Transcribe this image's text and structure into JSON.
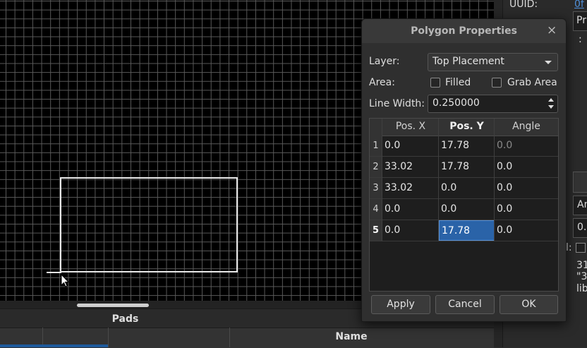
{
  "dialog": {
    "title": "Polygon Properties",
    "close": "×",
    "layer_label": "Layer:",
    "layer_value": "Top Placement",
    "area_label": "Area:",
    "filled_label": "Filled",
    "grab_area_label": "Grab Area",
    "filled_checked": false,
    "grab_area_checked": false,
    "line_width_label": "Line Width:",
    "line_width_value": "0.250000",
    "table": {
      "headers": [
        "Pos. X",
        "Pos. Y",
        "Angle"
      ],
      "rows": [
        {
          "n": "1",
          "x": "0.0",
          "y": "17.78",
          "angle": "0.0"
        },
        {
          "n": "2",
          "x": "33.02",
          "y": "17.78",
          "angle": "0.0"
        },
        {
          "n": "3",
          "x": "33.02",
          "y": "0.0",
          "angle": "0.0"
        },
        {
          "n": "4",
          "x": "0.0",
          "y": "0.0",
          "angle": "0.0"
        },
        {
          "n": "5",
          "x": "0.0",
          "y": "17.78",
          "angle": "0.0"
        }
      ]
    },
    "buttons": {
      "apply": "Apply",
      "cancel": "Cancel",
      "ok": "OK"
    }
  },
  "pads_dock": {
    "title": "Pads",
    "name_header": "Name"
  },
  "right_panel": {
    "uuid_label": "UUID:",
    "uuid_value": "0f",
    "field1": "Pr",
    "colon": ":",
    "field2": "An",
    "field3": "0.",
    "check_label": "l:",
    "text1": "31",
    "text2": "\"3",
    "text3": "lib"
  },
  "colors": {
    "canvas_bg": "#000000",
    "grid": "#5a5a5a",
    "polygon": "#e8e8e8",
    "selection": "#2a63a8",
    "link": "#4f8fd9"
  }
}
